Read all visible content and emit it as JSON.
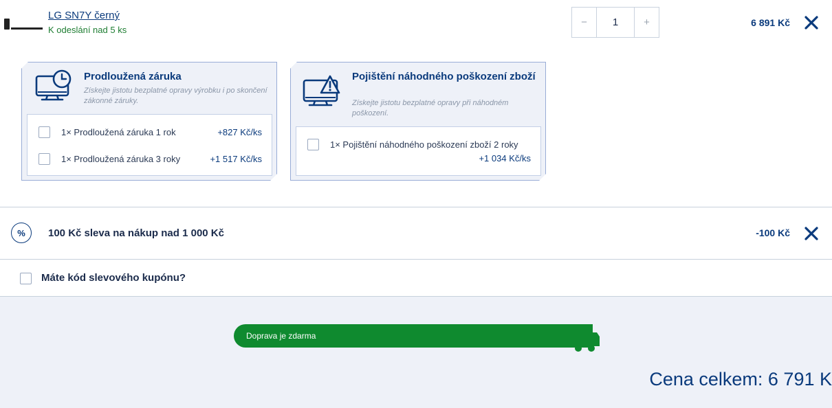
{
  "product": {
    "name": "LG SN7Y černý",
    "stock": "K odeslání nad 5 ks",
    "quantity": "1",
    "price": "6 891 Kč",
    "minus": "−",
    "plus": "+"
  },
  "warranty": {
    "title": "Prodloužená záruka",
    "desc": "Získejte jistotu bezplatné opravy výrobku i po skončení zákonné záruky.",
    "options": [
      {
        "label": "1× Prodloužená záruka 1 rok",
        "price": "+827 Kč/ks"
      },
      {
        "label": "1× Prodloužená záruka 3 roky",
        "price": "+1 517 Kč/ks"
      }
    ]
  },
  "insurance": {
    "title": "Pojištění náhodného poškození zboží",
    "desc": "Získejte jistotu bezplatné opravy při náhodném poškození.",
    "options": [
      {
        "label": "1× Pojištění náhodného poškození zboží 2 roky",
        "price": "+1 034 Kč/ks"
      }
    ]
  },
  "discount": {
    "icon_symbol": "%",
    "label": "100 Kč sleva na nákup nad 1 000 Kč",
    "value": "-100 Kč"
  },
  "coupon": {
    "label": "Máte kód slevového kupónu?"
  },
  "shipping": {
    "label": "Doprava je zdarma",
    "progress": 1.0
  },
  "total": {
    "label": "Cena celkem: 6 791 K"
  },
  "colors": {
    "accent": "#0a3a7c",
    "green": "#0f8a2f",
    "box_bg": "#eef1f8"
  }
}
